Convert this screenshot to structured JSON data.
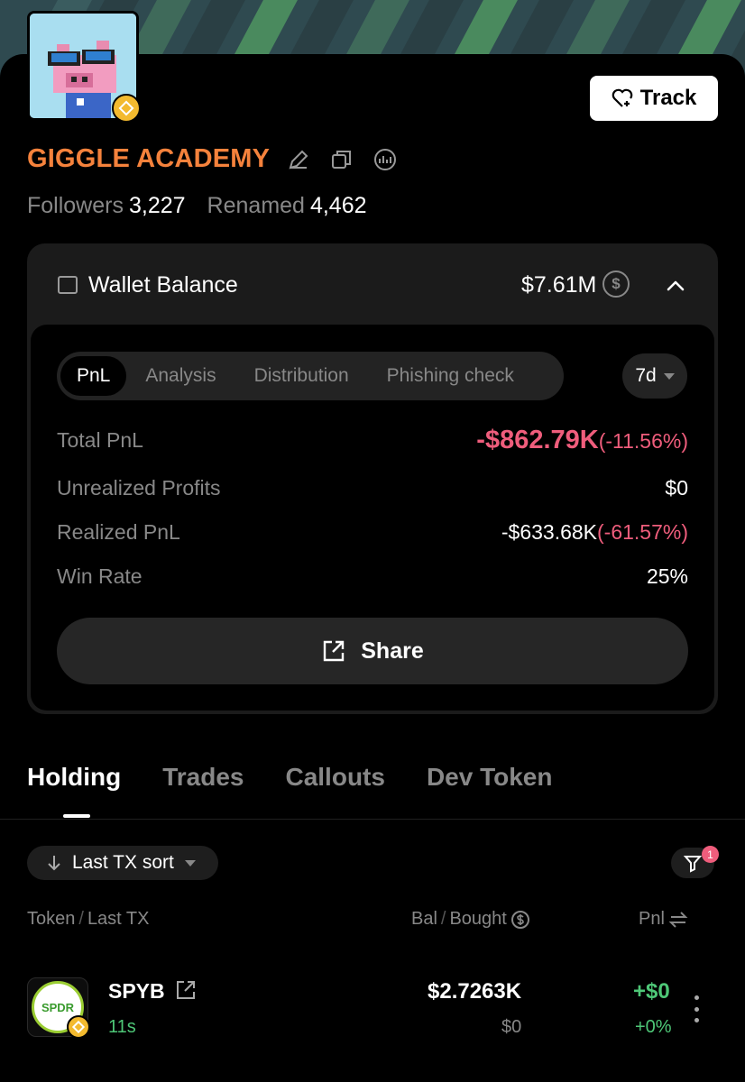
{
  "profile": {
    "name": "GIGGLE ACADEMY",
    "followers_label": "Followers",
    "followers_value": "3,227",
    "renamed_label": "Renamed",
    "renamed_value": "4,462",
    "track_label": "Track"
  },
  "wallet": {
    "title": "Wallet Balance",
    "balance": "$7.61M",
    "coin_symbol": "$"
  },
  "pnl_tabs": {
    "items": [
      "PnL",
      "Analysis",
      "Distribution",
      "Phishing check"
    ],
    "active": "PnL",
    "period": "7d"
  },
  "pnl_rows": {
    "total_label": "Total PnL",
    "total_value": "-$862.79K",
    "total_pct": "(-11.56%)",
    "unrealized_label": "Unrealized Profits",
    "unrealized_value": "$0",
    "realized_label": "Realized PnL",
    "realized_value": "-$633.68K",
    "realized_pct": "(-61.57%)",
    "winrate_label": "Win Rate",
    "winrate_value": "25%"
  },
  "share_label": "Share",
  "main_tabs": {
    "items": [
      "Holding",
      "Trades",
      "Callouts",
      "Dev Token"
    ],
    "active": "Holding"
  },
  "holdings": {
    "sort_label": "Last TX sort",
    "filter_count": "1",
    "col_token": "Token",
    "col_sep": "/",
    "col_last_tx": "Last TX",
    "col_bal": "Bal",
    "col_bought": "Bought",
    "col_pnl": "Pnl",
    "rows": [
      {
        "logo_text": "SPDR",
        "name": "SPYB",
        "time": "11s",
        "balance": "$2.7263K",
        "bought": "$0",
        "pnl": "+$0",
        "pnl_pct": "+0%"
      }
    ]
  },
  "colors": {
    "accent_orange": "#f5823c",
    "negative": "#ef5d7c",
    "positive": "#4ec777",
    "bnb_gold": "#f3ba2f"
  }
}
